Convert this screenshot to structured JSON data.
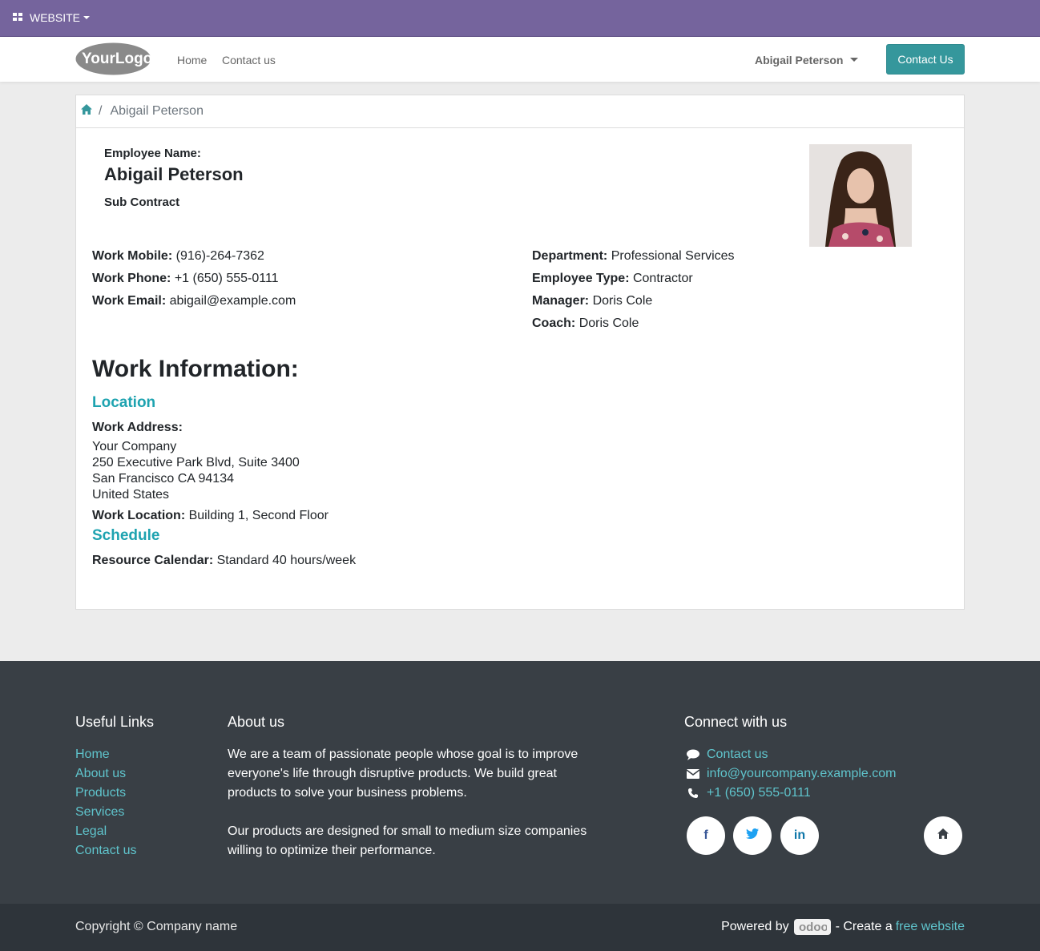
{
  "adminbar": {
    "menu_label": "WEBSITE"
  },
  "header": {
    "logo_text": "YourLogo",
    "nav": [
      "Home",
      "Contact us"
    ],
    "user_name": "Abigail Peterson",
    "contact_button": "Contact Us"
  },
  "breadcrumb": {
    "current": "Abigail Peterson"
  },
  "employee": {
    "name_label": "Employee Name:",
    "name": "Abigail Peterson",
    "job": "Sub Contract",
    "left_fields": [
      {
        "label": "Work Mobile:",
        "value": "(916)-264-7362"
      },
      {
        "label": "Work Phone:",
        "value": "+1 (650) 555-0111"
      },
      {
        "label": "Work Email:",
        "value": "abigail@example.com"
      }
    ],
    "right_fields": [
      {
        "label": "Department:",
        "value": "Professional Services"
      },
      {
        "label": "Employee Type:",
        "value": "Contractor"
      },
      {
        "label": "Manager:",
        "value": "Doris Cole"
      },
      {
        "label": "Coach:",
        "value": "Doris Cole"
      }
    ]
  },
  "work_info": {
    "title": "Work Information:",
    "location_title": "Location",
    "address_label": "Work Address:",
    "address_lines": [
      "Your Company",
      "250 Executive Park Blvd, Suite 3400",
      "San Francisco CA 94134",
      "United States"
    ],
    "work_location_label": "Work Location:",
    "work_location": "Building 1, Second Floor",
    "schedule_title": "Schedule",
    "calendar_label": "Resource Calendar:",
    "calendar_value": "Standard 40 hours/week"
  },
  "footer": {
    "useful_links_title": "Useful Links",
    "useful_links": [
      "Home",
      "About us",
      "Products",
      "Services",
      "Legal",
      "Contact us"
    ],
    "about_title": "About us",
    "about_p1": "We are a team of passionate people whose goal is to improve everyone's life through disruptive products. We build great products to solve your business problems.",
    "about_p2": "Our products are designed for small to medium size companies willing to optimize their performance.",
    "connect_title": "Connect with us",
    "connect_items": [
      {
        "icon": "comment-icon",
        "text": "Contact us"
      },
      {
        "icon": "envelope-icon",
        "text": "info@yourcompany.example.com"
      },
      {
        "icon": "phone-icon",
        "text": "+1 (650) 555-0111"
      }
    ],
    "social": [
      {
        "icon": "facebook-icon",
        "glyph": "f",
        "color": "#3b5998"
      },
      {
        "icon": "twitter-icon",
        "glyph": "🐦",
        "color": "#1da1f2"
      },
      {
        "icon": "linkedin-icon",
        "glyph": "in",
        "color": "#0e76a8"
      },
      {
        "icon": "home-icon",
        "glyph": "⌂",
        "color": "#393f45"
      }
    ]
  },
  "copyright": {
    "text": "Copyright © Company name",
    "powered_by": "Powered by",
    "odoo": "odoo",
    "create": "- Create a",
    "free_website": "free website"
  }
}
